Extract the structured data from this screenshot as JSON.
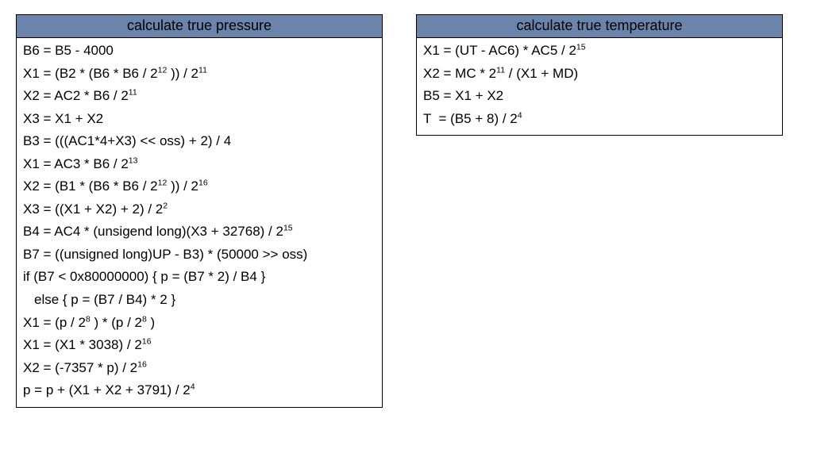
{
  "pressure": {
    "title": "calculate true pressure",
    "lines": [
      [
        {
          "t": "B6 = B5 - 4000"
        }
      ],
      [
        {
          "t": "X1 = (B2 * (B6 * B6 / 2"
        },
        {
          "sup": "12"
        },
        {
          "t": " )) / 2"
        },
        {
          "sup": "11"
        }
      ],
      [
        {
          "t": "X2 = AC2 * B6 / 2"
        },
        {
          "sup": "11"
        }
      ],
      [
        {
          "t": "X3 = X1 + X2"
        }
      ],
      [
        {
          "t": "B3 = (((AC1*4+X3) << oss) + 2) / 4"
        }
      ],
      [
        {
          "t": "X1 = AC3 * B6 / 2"
        },
        {
          "sup": "13"
        }
      ],
      [
        {
          "t": "X2 = (B1 * (B6 * B6 / 2"
        },
        {
          "sup": "12"
        },
        {
          "t": " )) / 2"
        },
        {
          "sup": "16"
        }
      ],
      [
        {
          "t": "X3 = ((X1 + X2) + 2) / 2"
        },
        {
          "sup": "2"
        }
      ],
      [
        {
          "t": "B4 = AC4 * (unsigend long)(X3 + 32768) / 2"
        },
        {
          "sup": "15"
        }
      ],
      [
        {
          "t": "B7 = ((unsigned long)UP - B3) * (50000 >> oss)"
        }
      ],
      [
        {
          "t": "if (B7 < 0x80000000) { p = (B7 * 2) / B4 }"
        }
      ],
      [
        {
          "indent": true,
          "t": "else { p = (B7 / B4) * 2 }"
        }
      ],
      [
        {
          "t": "X1 = (p / 2"
        },
        {
          "sup": "8"
        },
        {
          "t": " ) * (p / 2"
        },
        {
          "sup": "8"
        },
        {
          "t": " )"
        }
      ],
      [
        {
          "t": "X1 = (X1 * 3038) / 2"
        },
        {
          "sup": "16"
        }
      ],
      [
        {
          "t": "X2 = (-7357 * p) / 2"
        },
        {
          "sup": "16"
        }
      ],
      [
        {
          "t": "p = p + (X1 + X2 + 3791) / 2"
        },
        {
          "sup": "4"
        }
      ]
    ]
  },
  "temperature": {
    "title": "calculate true temperature",
    "lines": [
      [
        {
          "t": "X1 = (UT - AC6) * AC5 / 2"
        },
        {
          "sup": "15"
        }
      ],
      [
        {
          "t": "X2 = MC * 2"
        },
        {
          "sup": "11"
        },
        {
          "t": " / (X1 + MD)"
        }
      ],
      [
        {
          "t": "B5 = X1 + X2"
        }
      ],
      [
        {
          "t": "T  = (B5 + 8) / 2"
        },
        {
          "sup": "4"
        }
      ]
    ]
  }
}
